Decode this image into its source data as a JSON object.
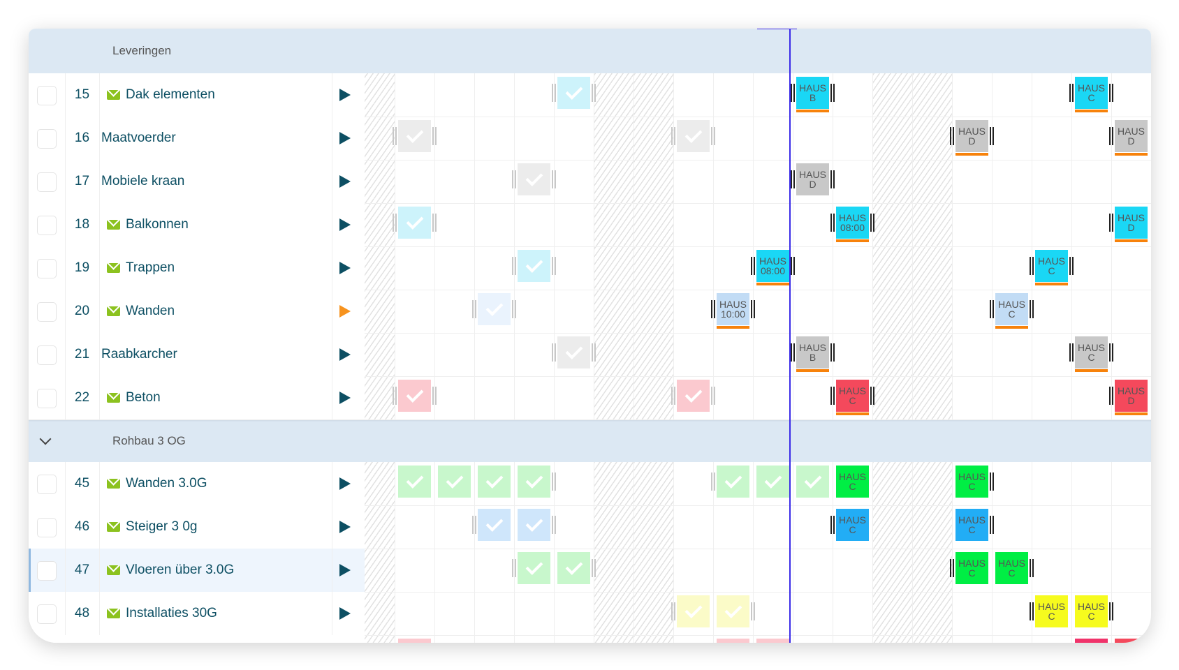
{
  "groups": [
    {
      "label": "Leveringen",
      "collapsible": false
    },
    {
      "label": "Rohbau 3 OG",
      "collapsible": true
    }
  ],
  "hatched_columns": [
    0,
    6,
    7,
    13,
    14
  ],
  "colors": {
    "text": "#0d4f63",
    "arrow": "#0d4f63",
    "arrow_active": "#f7931e",
    "mail": "#8cc21f",
    "underline": "#f7820b",
    "now_line": "#3a2be8"
  },
  "rows": [
    {
      "group": 0,
      "num": "15",
      "name": "Dak elementen",
      "mail": true,
      "items": [
        {
          "c": 5,
          "check": true,
          "bg": "#cdf3fb",
          "l": 1,
          "r": 1
        },
        {
          "c": 11,
          "top": "HAUS",
          "sub": "B",
          "bg": "#1ad7f5",
          "ul": true,
          "l": 1,
          "r": 1
        },
        {
          "c": 18,
          "top": "HAUS",
          "sub": "C",
          "bg": "#1ad7f5",
          "ul": true,
          "l": 1,
          "r": 1
        }
      ]
    },
    {
      "group": 0,
      "num": "16",
      "name": "Maatvoerder",
      "mail": false,
      "items": [
        {
          "c": 1,
          "check": true,
          "bg": "#ececec",
          "l": 1,
          "r": 1
        },
        {
          "c": 8,
          "check": true,
          "bg": "#ececec",
          "l": 1,
          "r": 1
        },
        {
          "c": 15,
          "top": "HAUS",
          "sub": "D",
          "bg": "#c8c8c8",
          "ul": true,
          "l": 1,
          "r": 1
        },
        {
          "c": 19,
          "top": "HAUS",
          "sub": "D",
          "bg": "#c8c8c8",
          "ul": true,
          "l": 1
        }
      ]
    },
    {
      "group": 0,
      "num": "17",
      "name": "Mobiele kraan",
      "mail": false,
      "items": [
        {
          "c": 4,
          "check": true,
          "bg": "#ececec",
          "l": 1,
          "r": 1
        },
        {
          "c": 11,
          "top": "HAUS",
          "sub": "D",
          "bg": "#c8c8c8",
          "l": 1,
          "r": 1
        }
      ]
    },
    {
      "group": 0,
      "num": "18",
      "name": "Balkonnen",
      "mail": true,
      "items": [
        {
          "c": 1,
          "check": true,
          "bg": "#cdf3fb",
          "l": 1,
          "r": 1
        },
        {
          "c": 12,
          "top": "HAUS",
          "sub": "08:00",
          "bg": "#1ad7f5",
          "ul": true,
          "l": 1,
          "r": 1
        },
        {
          "c": 19,
          "top": "HAUS",
          "sub": "D",
          "bg": "#1ad7f5",
          "ul": true,
          "l": 1
        }
      ]
    },
    {
      "group": 0,
      "num": "19",
      "name": "Trappen",
      "mail": true,
      "items": [
        {
          "c": 4,
          "check": true,
          "bg": "#cdf3fb",
          "l": 1,
          "r": 1
        },
        {
          "c": 10,
          "top": "HAUS",
          "sub": "08:00",
          "bg": "#1ad7f5",
          "ul": true,
          "l": 1,
          "r": 1
        },
        {
          "c": 17,
          "top": "HAUS",
          "sub": "C",
          "bg": "#1ad7f5",
          "ul": true,
          "l": 1,
          "r": 1
        }
      ]
    },
    {
      "group": 0,
      "num": "20",
      "name": "Wanden",
      "mail": true,
      "active": true,
      "items": [
        {
          "c": 3,
          "check": true,
          "bg": "#eaf3fd",
          "l": 1,
          "r": 1
        },
        {
          "c": 9,
          "top": "HAUS",
          "sub": "10:00",
          "bg": "#c2dcf5",
          "ul": true,
          "l": 1,
          "r": 1
        },
        {
          "c": 16,
          "top": "HAUS",
          "sub": "C",
          "bg": "#c2dcf5",
          "ul": true,
          "l": 1,
          "r": 1
        }
      ]
    },
    {
      "group": 0,
      "num": "21",
      "name": "Raabkarcher",
      "mail": false,
      "items": [
        {
          "c": 5,
          "check": true,
          "bg": "#ececec",
          "l": 1,
          "r": 1
        },
        {
          "c": 11,
          "top": "HAUS",
          "sub": "B",
          "bg": "#c8c8c8",
          "ul": true,
          "l": 1,
          "r": 1
        },
        {
          "c": 18,
          "top": "HAUS",
          "sub": "C",
          "bg": "#c8c8c8",
          "ul": true,
          "l": 1,
          "r": 1
        }
      ]
    },
    {
      "group": 0,
      "num": "22",
      "name": "Beton",
      "mail": true,
      "items": [
        {
          "c": 1,
          "check": true,
          "bg": "#fbc9cf",
          "l": 1,
          "r": 1
        },
        {
          "c": 8,
          "check": true,
          "bg": "#fbc9cf",
          "l": 1,
          "r": 1
        },
        {
          "c": 12,
          "top": "HAUS",
          "sub": "C",
          "bg": "#f4495c",
          "ul": true,
          "l": 1,
          "r": 1
        },
        {
          "c": 19,
          "top": "HAUS",
          "sub": "D",
          "bg": "#f4495c",
          "ul": true,
          "l": 1
        }
      ]
    },
    {
      "group": 1,
      "num": "45",
      "name": "Wanden 3.0G",
      "mail": true,
      "items": [
        {
          "c": 1,
          "check": true,
          "bg": "#c8f7cc"
        },
        {
          "c": 2,
          "check": true,
          "bg": "#c8f7cc"
        },
        {
          "c": 3,
          "check": true,
          "bg": "#c8f7cc"
        },
        {
          "c": 4,
          "check": true,
          "bg": "#c8f7cc",
          "r": 1
        },
        {
          "c": 9,
          "check": true,
          "bg": "#c8f7cc",
          "l": 1
        },
        {
          "c": 10,
          "check": true,
          "bg": "#c8f7cc"
        },
        {
          "c": 11,
          "check": true,
          "bg": "#c8f7cc"
        },
        {
          "c": 12,
          "top": "HAUS",
          "sub": "C",
          "bg": "#00ee44"
        },
        {
          "c": 15,
          "top": "HAUS",
          "sub": "C",
          "bg": "#00ee44",
          "r": 1
        }
      ]
    },
    {
      "group": 1,
      "num": "46",
      "name": "Steiger 3 0g",
      "mail": true,
      "items": [
        {
          "c": 3,
          "check": true,
          "bg": "#cfe6fb",
          "l": 1
        },
        {
          "c": 4,
          "check": true,
          "bg": "#cfe6fb",
          "r": 1
        },
        {
          "c": 12,
          "top": "HAUS",
          "sub": "C",
          "bg": "#22adf5",
          "l": 1
        },
        {
          "c": 15,
          "top": "HAUS",
          "sub": "C",
          "bg": "#22adf5",
          "r": 1
        }
      ]
    },
    {
      "group": 1,
      "num": "47",
      "name": "Vloeren über 3.0G",
      "mail": true,
      "selected": true,
      "items": [
        {
          "c": 4,
          "check": true,
          "bg": "#c8f7cc",
          "l": 1
        },
        {
          "c": 5,
          "check": true,
          "bg": "#c8f7cc",
          "r": 1
        },
        {
          "c": 15,
          "top": "HAUS",
          "sub": "C",
          "bg": "#00ee44",
          "l": 1
        },
        {
          "c": 16,
          "top": "HAUS",
          "sub": "C",
          "bg": "#00ee44",
          "r": 1
        }
      ]
    },
    {
      "group": 1,
      "num": "48",
      "name": "Installaties 30G",
      "mail": true,
      "items": [
        {
          "c": 8,
          "check": true,
          "bg": "#fbfbc8",
          "l": 1
        },
        {
          "c": 9,
          "check": true,
          "bg": "#fbfbc8",
          "r": 1
        },
        {
          "c": 17,
          "top": "HAUS",
          "sub": "C",
          "bg": "#f6fb1e",
          "l": 1
        },
        {
          "c": 18,
          "top": "HAUS",
          "sub": "C",
          "bg": "#f6fb1e",
          "r": 1
        }
      ]
    }
  ],
  "partial_row_items": [
    {
      "c": 1,
      "bg": "#fbc9cf"
    },
    {
      "c": 9,
      "bg": "#fbc9cf"
    },
    {
      "c": 10,
      "bg": "#fbc9cf"
    },
    {
      "c": 18,
      "bg": "#f0336a"
    },
    {
      "c": 19,
      "bg": "#f4495c"
    }
  ]
}
